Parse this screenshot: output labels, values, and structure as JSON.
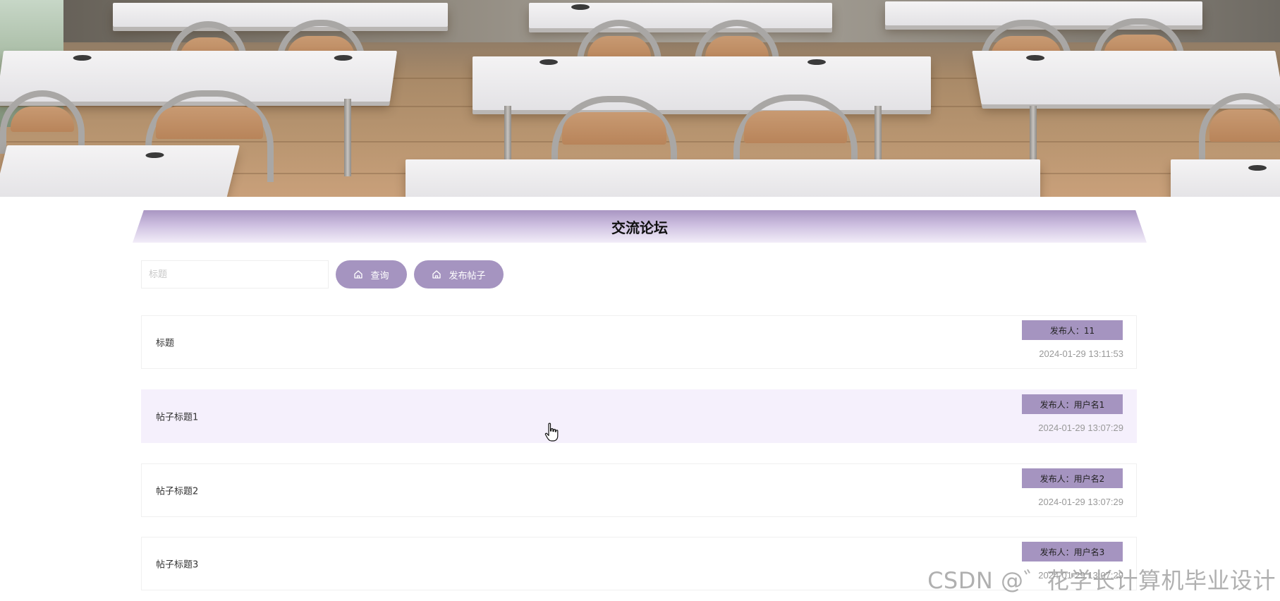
{
  "header": {
    "title": "交流论坛"
  },
  "search": {
    "placeholder": "标题",
    "value": "",
    "query_label": "查询",
    "post_label": "发布帖子",
    "button_icon": "home-icon"
  },
  "posts": [
    {
      "title": "标题",
      "author": "发布人：11",
      "time": "2024-01-29 13:11:53"
    },
    {
      "title": "帖子标题1",
      "author": "发布人：用户名1",
      "time": "2024-01-29 13:07:29"
    },
    {
      "title": "帖子标题2",
      "author": "发布人：用户名2",
      "time": "2024-01-29 13:07:29"
    },
    {
      "title": "帖子标题3",
      "author": "发布人：用户名3",
      "time": "2024-01-29 13:07:29"
    }
  ],
  "watermark": "CSDN @゛花学长计算机毕业设计",
  "colors": {
    "accent": "#a594c0",
    "row_hover": "#f5f0fc",
    "time_text": "#999999"
  }
}
